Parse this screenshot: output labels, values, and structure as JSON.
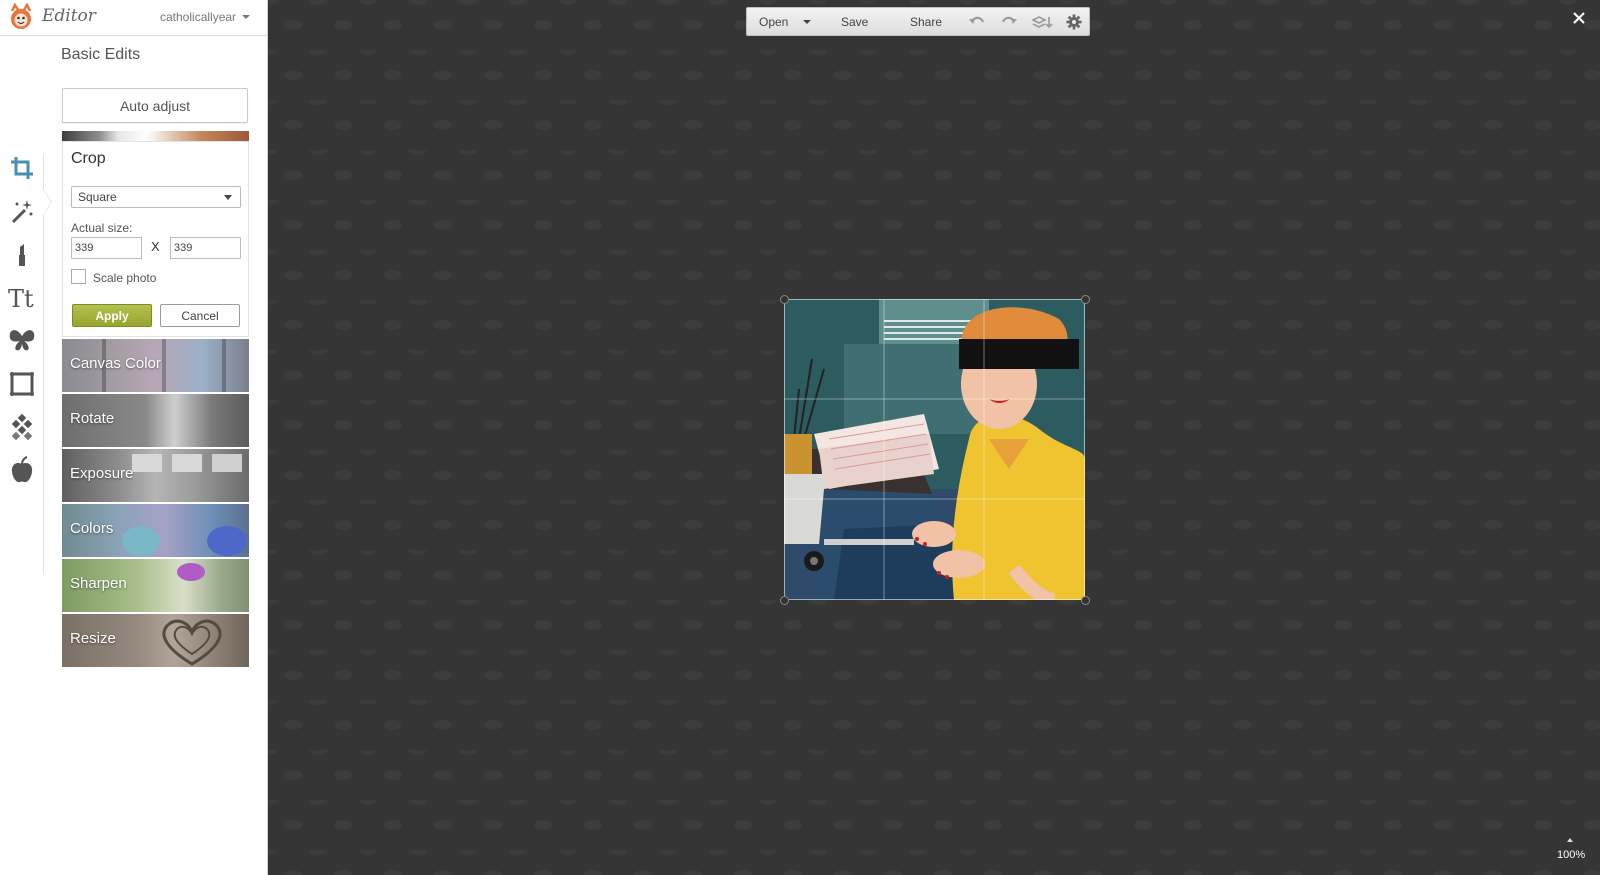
{
  "app": {
    "title": "Editor",
    "account": "catholicallyear"
  },
  "panel": {
    "section_title": "Basic Edits",
    "auto_adjust": "Auto adjust"
  },
  "crop": {
    "title": "Crop",
    "preset": "Square",
    "actual_size_label": "Actual size:",
    "width": "339",
    "height": "339",
    "x_separator": "X",
    "scale_photo": "Scale photo",
    "scale_checked": false,
    "apply": "Apply",
    "cancel": "Cancel"
  },
  "tools": [
    {
      "label": "Canvas Color"
    },
    {
      "label": "Rotate"
    },
    {
      "label": "Exposure"
    },
    {
      "label": "Colors"
    },
    {
      "label": "Sharpen"
    },
    {
      "label": "Resize"
    }
  ],
  "rail_icons": [
    "crop-icon",
    "magic-wand-icon",
    "lipstick-icon",
    "text-icon",
    "butterfly-icon",
    "frame-icon",
    "texture-icon",
    "apple-icon"
  ],
  "toolbar": {
    "open": "Open",
    "save": "Save",
    "share": "Share",
    "icons": [
      "undo-icon",
      "redo-icon",
      "layers-icon",
      "settings-icon"
    ]
  },
  "zoom": "100%",
  "colors": {
    "accent": "#4a8fb3",
    "apply_green": "#a3b23a",
    "workspace": "#353535"
  }
}
